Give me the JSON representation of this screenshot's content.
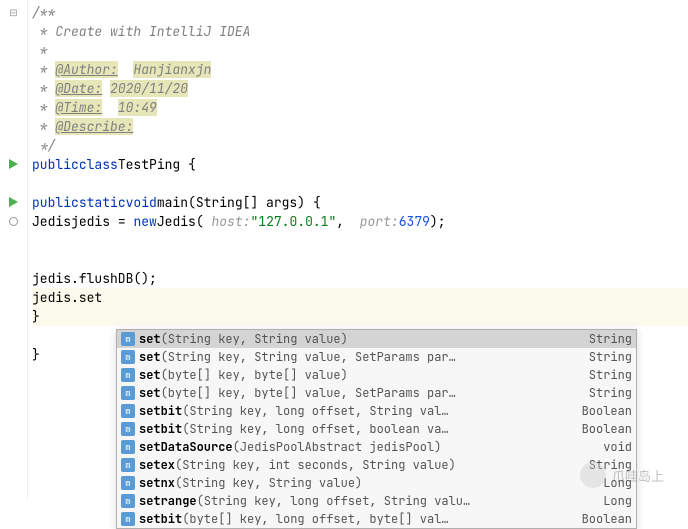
{
  "doc": {
    "start": "/**",
    "l1": " * Create with IntelliJ IDEA",
    "l2": " *",
    "authorTag": "@Author:",
    "authorVal": "Hanjianxjn",
    "dateTag": "@Date:",
    "dateVal": "2020/11/20",
    "timeTag": "@Time:",
    "timeVal": "10:49",
    "descTag": "@Describe:",
    "end": " */",
    "prefix": " * "
  },
  "code": {
    "pub": "public",
    "cls": "class",
    "clsName": "TestPing",
    "stat": "static",
    "vd": "void",
    "main": "main",
    "mainArgs": "(String[] args) {",
    "jedisType": "Jedis",
    "jedisVar": "jedis",
    "eq": " = ",
    "nw": "new",
    "jedisCtor": "Jedis",
    "hostHint": "host:",
    "hostVal": "\"127.0.0.1\"",
    "portHint": "port:",
    "portVal": "6379",
    "flush": "jedis.flushDB();",
    "setCall": "jedis.set",
    "openBrace": " {",
    "closeBrace": "}"
  },
  "popup": {
    "items": [
      {
        "name": "set",
        "sig": "(String key, String value)",
        "ret": "String"
      },
      {
        "name": "set",
        "sig": "(String key, String value, SetParams par…",
        "ret": "String"
      },
      {
        "name": "set",
        "sig": "(byte[] key, byte[] value)",
        "ret": "String"
      },
      {
        "name": "set",
        "sig": "(byte[] key, byte[] value, SetParams par…",
        "ret": "String"
      },
      {
        "name": "setbit",
        "sig": "(String key, long offset, String val…",
        "ret": "Boolean"
      },
      {
        "name": "setbit",
        "sig": "(String key, long offset, boolean va…",
        "ret": "Boolean"
      },
      {
        "name": "setDataSource",
        "sig": "(JedisPoolAbstract jedisPool)",
        "ret": "void"
      },
      {
        "name": "setex",
        "sig": "(String key, int seconds, String value)",
        "ret": "String"
      },
      {
        "name": "setnx",
        "sig": "(String key, String value)",
        "ret": "Long"
      },
      {
        "name": "setrange",
        "sig": "(String key, long offset, String valu…",
        "ret": "Long"
      },
      {
        "name": "setbit",
        "sig": "(byte[] key, long offset, byte[] val…",
        "ret": "Boolean"
      }
    ]
  },
  "watermark": {
    "text": "爪哇岛上"
  }
}
